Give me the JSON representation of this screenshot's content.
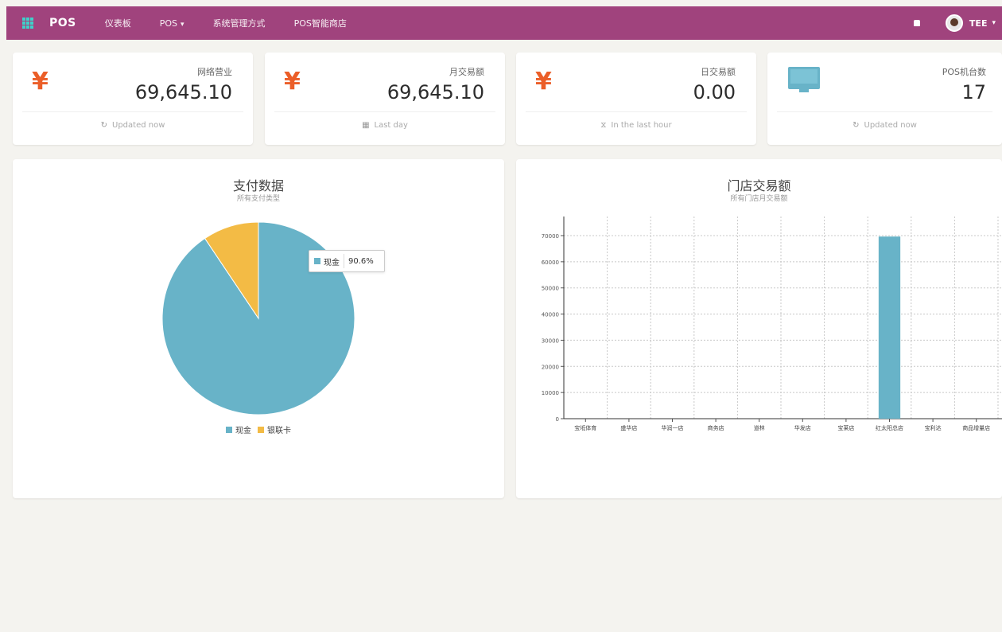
{
  "nav": {
    "brand": "POS",
    "items": [
      {
        "label": "仪表板",
        "caret": ""
      },
      {
        "label": "POS",
        "caret": "▾"
      },
      {
        "label": "系统管理方式",
        "caret": ""
      },
      {
        "label": "POS智能商店",
        "caret": ""
      }
    ],
    "user_name": "TEE",
    "user_caret": "▾"
  },
  "stats": [
    {
      "label": "网络营业",
      "value": "69,645.10",
      "icon": "yen-icon",
      "footer_icon": "↻",
      "footer": "Updated now"
    },
    {
      "label": "月交易额",
      "value": "69,645.10",
      "icon": "yen-icon",
      "footer_icon": "▦",
      "footer": "Last day"
    },
    {
      "label": "日交易额",
      "value": "0.00",
      "icon": "yen-icon",
      "footer_icon": "⧖",
      "footer": "In the last hour"
    },
    {
      "label": "POS机台数",
      "value": "17",
      "icon": "monitor-icon",
      "footer_icon": "↻",
      "footer": "Updated now"
    }
  ],
  "pie_panel": {
    "title": "支付数据",
    "subtitle": "所有支付类型",
    "tooltip": {
      "name": "现金",
      "value": "90.6%"
    },
    "legend": [
      {
        "name": "现金",
        "color": "#68b3c8"
      },
      {
        "name": "银联卡",
        "color": "#f3bb45"
      }
    ]
  },
  "bar_panel": {
    "title": "门店交易额",
    "subtitle": "所有门店月交易额"
  },
  "chart_data": [
    {
      "type": "pie",
      "title": "支付数据",
      "subtitle": "所有支付类型",
      "categories": [
        "现金",
        "银联卡"
      ],
      "values": [
        90.6,
        9.4
      ],
      "colors": [
        "#68b3c8",
        "#f3bb45"
      ],
      "legend": "bottom"
    },
    {
      "type": "bar",
      "title": "门店交易额",
      "subtitle": "所有门店月交易额",
      "categories": [
        "宝坻体育",
        "盛华店",
        "华润一店",
        "商务店",
        "道林",
        "华发店",
        "宝莱店",
        "红太阳总店",
        "宝利达",
        "商品增量店"
      ],
      "values": [
        0,
        0,
        0,
        0,
        0,
        0,
        0,
        69645.1,
        0,
        0
      ],
      "ylim": [
        0,
        70000
      ],
      "yticks": [
        0,
        10000,
        20000,
        30000,
        40000,
        50000,
        60000,
        70000
      ],
      "ytick_labels": [
        "0",
        "10000",
        "20000",
        "30000",
        "40000",
        "50000",
        "60000",
        "70000"
      ],
      "grid": true,
      "color": "#68b3c8"
    }
  ]
}
